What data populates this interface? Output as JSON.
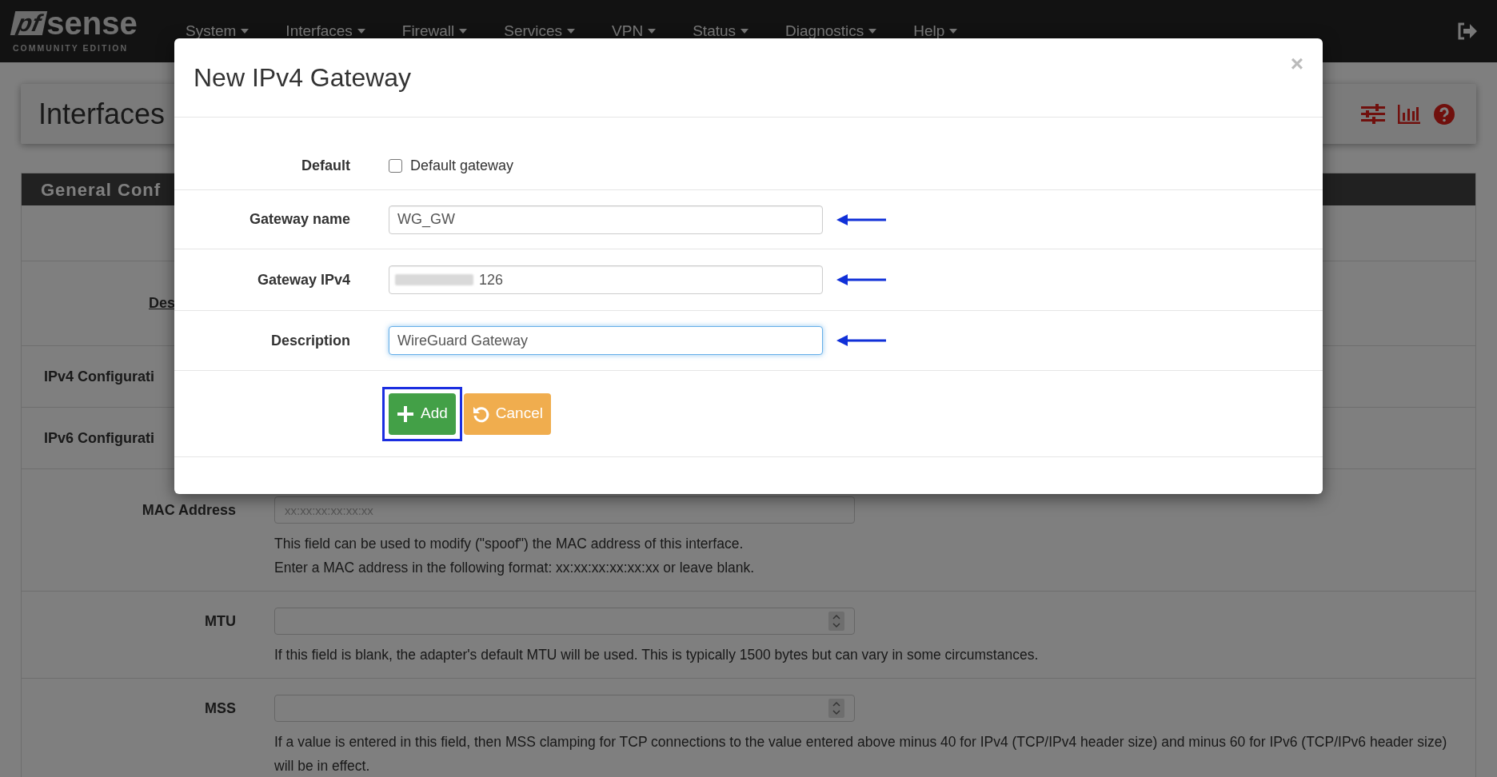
{
  "navbar": {
    "logo": {
      "prefix": "pf",
      "brand": "sense",
      "subtitle": "COMMUNITY EDITION"
    },
    "menus": [
      {
        "label": "System"
      },
      {
        "label": "Interfaces"
      },
      {
        "label": "Firewall"
      },
      {
        "label": "Services"
      },
      {
        "label": "VPN"
      },
      {
        "label": "Status"
      },
      {
        "label": "Diagnostics"
      },
      {
        "label": "Help"
      }
    ]
  },
  "page": {
    "title": "Interfaces",
    "section_title": "General Conf",
    "rows": [
      {
        "kind": "link",
        "label": "Des"
      },
      {
        "kind": "heading",
        "label": "IPv4 Configurati"
      },
      {
        "kind": "heading",
        "label": "IPv6 Configurati"
      },
      {
        "kind": "text",
        "label": "MAC Address",
        "placeholder": "xx:xx:xx:xx:xx:xx",
        "help": [
          "This field can be used to modify (\"spoof\") the MAC address of this interface.",
          "Enter a MAC address in the following format: xx:xx:xx:xx:xx:xx or leave blank."
        ]
      },
      {
        "kind": "number",
        "label": "MTU",
        "help": [
          "If this field is blank, the adapter's default MTU will be used. This is typically 1500 bytes but can vary in some circumstances."
        ]
      },
      {
        "kind": "number",
        "label": "MSS",
        "help": [
          "If a value is entered in this field, then MSS clamping for TCP connections to the value entered above minus 40 for IPv4 (TCP/IPv4 header size) and minus 60 for IPv6 (TCP/IPv6 header size) will be in effect."
        ]
      }
    ]
  },
  "modal": {
    "title": "New IPv4 Gateway",
    "close": "×",
    "rows": [
      {
        "kind": "checkbox",
        "label": "Default",
        "text": "Default gateway",
        "checked": false
      },
      {
        "kind": "input",
        "label": "Gateway name",
        "value": "WG_GW",
        "focused": false,
        "redacted": false,
        "annotated": true
      },
      {
        "kind": "input",
        "label": "Gateway IPv4",
        "value": "126",
        "focused": false,
        "redacted": true,
        "annotated": true
      },
      {
        "kind": "input",
        "label": "Description",
        "value": "WireGuard Gateway",
        "focused": true,
        "redacted": false,
        "annotated": true
      }
    ],
    "buttons": [
      {
        "kind": "add",
        "label": "Add",
        "highlighted": true
      },
      {
        "kind": "cancel",
        "label": "Cancel",
        "highlighted": false
      }
    ]
  }
}
